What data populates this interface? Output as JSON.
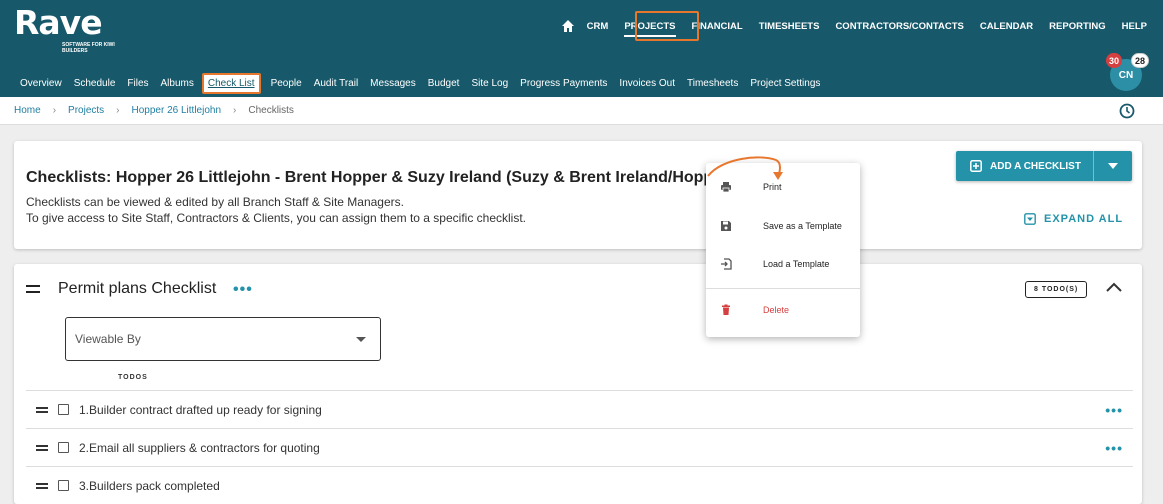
{
  "brand": {
    "name": "Rave",
    "tagline": "SOFTWARE FOR KIWI BUILDERS"
  },
  "top_nav": [
    "CRM",
    "PROJECTS",
    "FINANCIAL",
    "TIMESHEETS",
    "CONTRACTORS/CONTACTS",
    "CALENDAR",
    "REPORTING",
    "HELP"
  ],
  "top_nav_active": "PROJECTS",
  "sub_nav": [
    "Overview",
    "Schedule",
    "Files",
    "Albums",
    "Check List",
    "People",
    "Audit Trail",
    "Messages",
    "Budget",
    "Site Log",
    "Progress Payments",
    "Invoices Out",
    "Timesheets",
    "Project Settings"
  ],
  "sub_nav_active": "Check List",
  "user": {
    "initials": "CN",
    "notifications": "30",
    "messages": "28"
  },
  "breadcrumb": [
    "Home",
    "Projects",
    "Hopper 26 Littlejohn",
    "Checklists"
  ],
  "header_card": {
    "title": "Checklists: Hopper 26 Littlejohn - Brent Hopper & Suzy Ireland (Suzy & Brent Ireland/Hopper)",
    "desc_line1": "Checklists can be viewed & edited by all Branch Staff & Site Managers.",
    "desc_line2": "To give access to Site Staff, Contractors & Clients, you can assign them to a specific checklist.",
    "add_button": "ADD A CHECKLIST",
    "expand_all": "EXPAND ALL"
  },
  "checklist": {
    "title": "Permit plans Checklist",
    "todo_badge": "8 TODO(S)",
    "viewable_placeholder": "Viewable By",
    "todos_header": "TODOS",
    "items": [
      "1.Builder contract drafted up ready for signing",
      "2.Email all suppliers & contractors for quoting",
      "3.Builders pack completed"
    ]
  },
  "context_menu": {
    "print": "Print",
    "save_template": "Save as a Template",
    "load_template": "Load a Template",
    "delete": "Delete"
  },
  "colors": {
    "header_bg": "#17596a",
    "accent": "#2493a9",
    "highlight": "#e8772e",
    "danger": "#d63f3f"
  }
}
